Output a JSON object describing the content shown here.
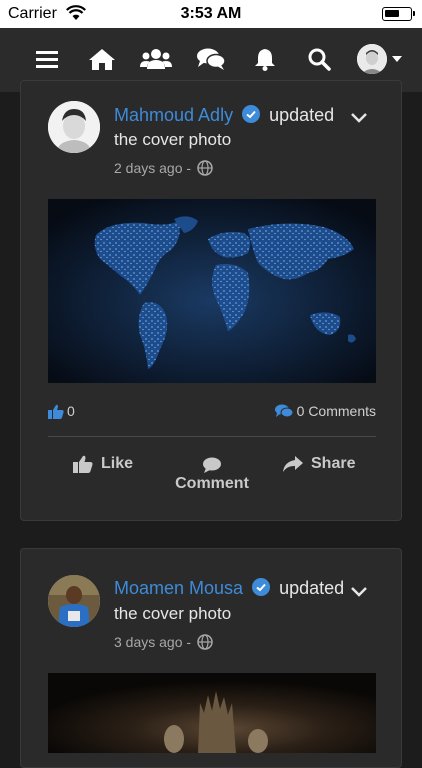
{
  "status": {
    "carrier": "Carrier",
    "time": "3:53 AM"
  },
  "nav": {
    "icons": [
      "menu-icon",
      "home-icon",
      "groups-icon",
      "messages-icon",
      "notifications-icon",
      "search-icon",
      "profile-avatar",
      "dropdown-icon"
    ]
  },
  "posts": [
    {
      "author": "Mahmoud Adly",
      "action": "updated",
      "subtitle": "the cover photo",
      "time": "2 days ago -",
      "likes": "0",
      "comments": "0 Comments",
      "actions": {
        "like": "Like",
        "comment": "Comment",
        "share": "Share"
      }
    },
    {
      "author": "Moamen Mousa",
      "action": "updated",
      "subtitle": "the cover photo",
      "time": "3 days ago -"
    }
  ],
  "colors": {
    "accent": "#3d8bd9",
    "background": "#1c1c1c",
    "card": "#2a2a2a",
    "navbar": "#2b2b2b"
  }
}
